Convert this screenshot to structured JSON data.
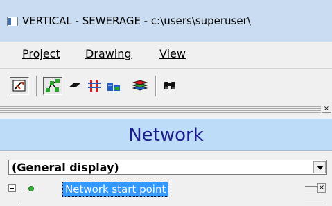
{
  "window": {
    "title": "VERTICAL - SEWERAGE - c:\\users\\superuser\\"
  },
  "menu": [
    {
      "label": "Project"
    },
    {
      "label": "Drawing"
    },
    {
      "label": "View"
    }
  ],
  "toolbar": {
    "buttons": [
      {
        "name": "preview-tool",
        "pressed": true
      },
      {
        "name": "network-tool",
        "pressed": true
      },
      {
        "name": "surface-tool",
        "pressed": false
      },
      {
        "name": "profile-tool",
        "pressed": false
      },
      {
        "name": "blocks-tool",
        "pressed": false
      },
      {
        "name": "layers-tool",
        "pressed": false
      },
      {
        "name": "find-tool",
        "pressed": false
      }
    ]
  },
  "panel": {
    "title": "Network",
    "close_glyph": "×"
  },
  "combo": {
    "value": "(General display)"
  },
  "tree": {
    "items": [
      {
        "label": "Network start point",
        "selected": true
      }
    ]
  }
}
